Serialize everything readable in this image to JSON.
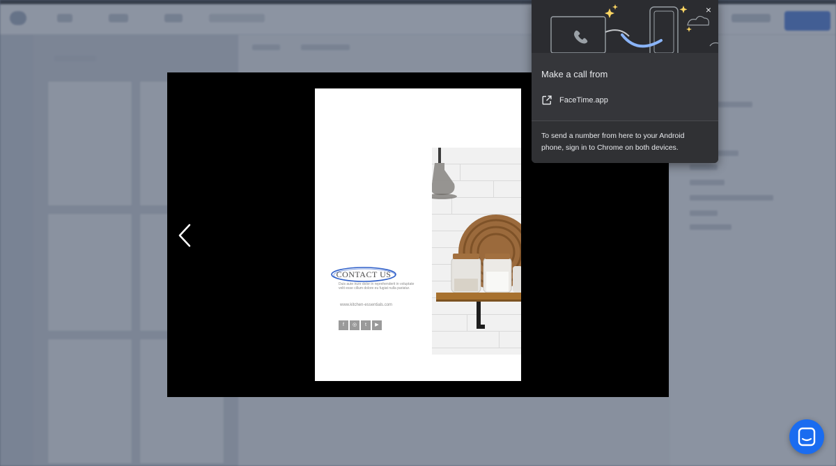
{
  "lightbox": {
    "page": {
      "contact_title": "CONTACT US",
      "contact_body": "Duis aute irure dolor in reprehenderit in voluptate velit esse cillum dolore eu fugiat nulla pariatur.",
      "contact_url": "www.kitchen-essentials.com",
      "social_icons": [
        "facebook-icon",
        "instagram-icon",
        "twitter-icon",
        "youtube-icon"
      ],
      "social_glyphs": [
        "f",
        "◎",
        "t",
        "▶"
      ]
    }
  },
  "popup": {
    "title": "Make a call from",
    "option_label": "FaceTime.app",
    "note": "To send a number from here to your Android phone, sign in to Chrome on both devices.",
    "close_glyph": "×"
  },
  "colors": {
    "accent_blue": "#8ab4f8",
    "chat_button": "#1a6cf0",
    "popup_bg": "#35363a"
  }
}
